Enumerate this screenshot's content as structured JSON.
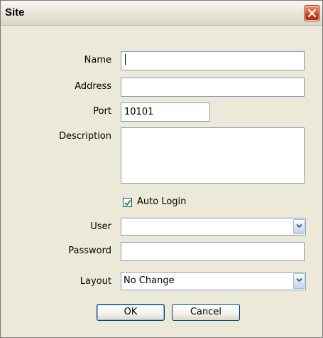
{
  "window": {
    "title": "Site"
  },
  "form": {
    "name_label": "Name",
    "name_value": "",
    "address_label": "Address",
    "address_value": "",
    "port_label": "Port",
    "port_value": "10101",
    "description_label": "Description",
    "description_value": "",
    "auto_login_label": "Auto Login",
    "auto_login_checked": true,
    "user_label": "User",
    "user_value": "",
    "password_label": "Password",
    "password_value": "",
    "layout_label": "Layout",
    "layout_value": "No Change"
  },
  "buttons": {
    "ok_label": "OK",
    "cancel_label": "Cancel"
  },
  "colors": {
    "dialog_bg": "#ece9d8",
    "field_border": "#7f9db9",
    "close_button": "#c8431f"
  },
  "icons": {
    "close": "close-icon",
    "dropdown": "chevron-down-icon",
    "check": "checkmark-icon"
  }
}
